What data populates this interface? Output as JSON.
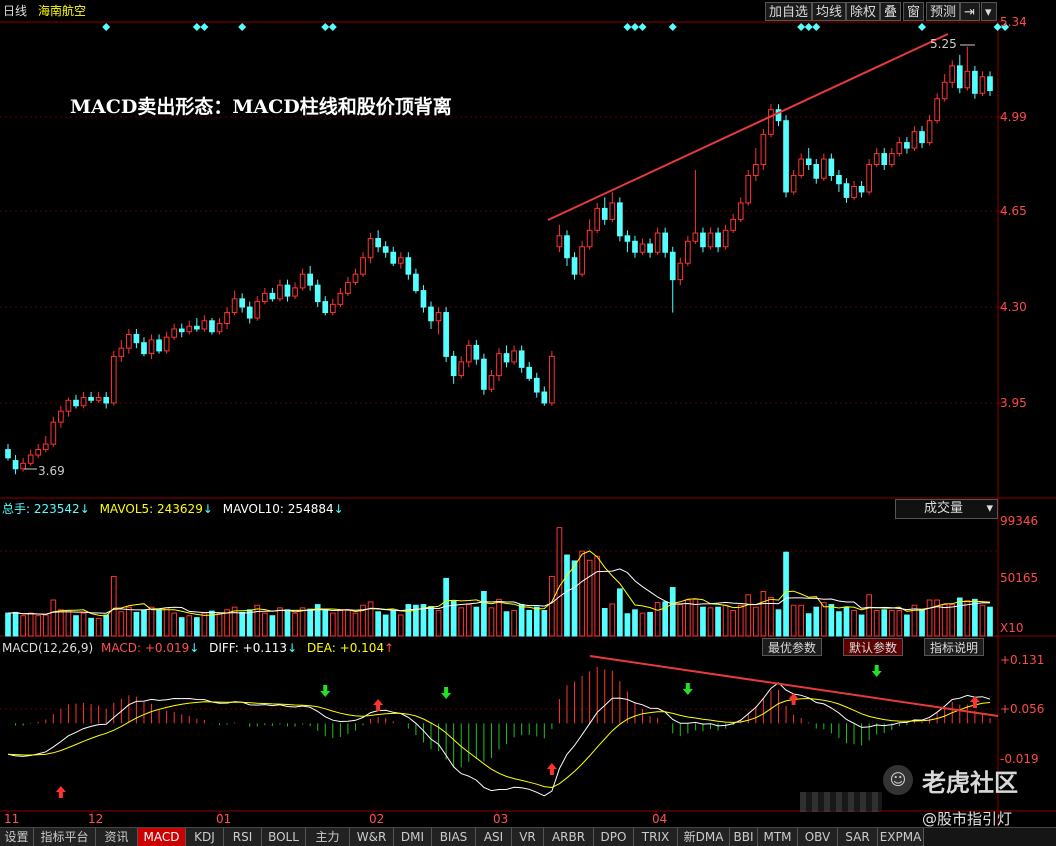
{
  "header": {
    "period": "日线",
    "stock_name": "海南航空",
    "buttons": [
      "加自选",
      "均线",
      "除权",
      "叠",
      "窗",
      "预测"
    ]
  },
  "annotation": {
    "title": "MACD卖出形态：MACD柱线和股价顶背离"
  },
  "price_axis": [
    "5.34",
    "4.99",
    "4.65",
    "4.30",
    "3.95"
  ],
  "price_marks": {
    "high": "5.25",
    "low": "3.69"
  },
  "volume_header": {
    "total_label": "总手:",
    "total_value": "223542",
    "mavol5_label": "MAVOL5:",
    "mavol5_value": "243629",
    "mavol10_label": "MAVOL10:",
    "mavol10_value": "254884",
    "selector": "成交量"
  },
  "volume_axis": [
    "99346",
    "50165",
    "X10"
  ],
  "macd_header": {
    "name": "MACD(12,26,9)",
    "macd_label": "MACD:",
    "macd_value": "+0.019",
    "diff_label": "DIFF:",
    "diff_value": "+0.113",
    "dea_label": "DEA:",
    "dea_value": "+0.104"
  },
  "macd_buttons": [
    "最优参数",
    "默认参数",
    "指标说明"
  ],
  "macd_axis": [
    "+0.131",
    "+0.056",
    "-0.019"
  ],
  "x_axis_months": [
    "11",
    "12",
    "01",
    "02",
    "03",
    "04"
  ],
  "bottom_tabs": [
    "设置",
    "指标平台",
    "资讯",
    "MACD",
    "KDJ",
    "RSI",
    "BOLL",
    "主力",
    "W&R",
    "DMI",
    "BIAS",
    "ASI",
    "VR",
    "ARBR",
    "DPO",
    "TRIX",
    "新DMA",
    "BBI",
    "MTM",
    "OBV",
    "SAR",
    "EXPMA"
  ],
  "watermark": {
    "brand": "老虎社区",
    "author": "@股市指引灯"
  },
  "colors": {
    "up": "#ff3232",
    "down": "#54ffff",
    "diff": "#ffffff",
    "dea": "#ffff00",
    "trend": "#e83a3a",
    "grid": "#8b0000"
  },
  "chart_data": {
    "type": "candlestick",
    "price_range": [
      3.62,
      5.4
    ],
    "candles": [
      [
        3.78,
        3.75,
        3.8,
        3.74
      ],
      [
        3.74,
        3.71,
        3.76,
        3.69
      ],
      [
        3.71,
        3.73,
        3.75,
        3.7
      ],
      [
        3.73,
        3.76,
        3.78,
        3.72
      ],
      [
        3.76,
        3.78,
        3.8,
        3.75
      ],
      [
        3.78,
        3.8,
        3.83,
        3.77
      ],
      [
        3.8,
        3.88,
        3.9,
        3.79
      ],
      [
        3.88,
        3.92,
        3.94,
        3.86
      ],
      [
        3.92,
        3.96,
        3.97,
        3.9
      ],
      [
        3.96,
        3.94,
        3.98,
        3.93
      ],
      [
        3.94,
        3.97,
        3.99,
        3.93
      ],
      [
        3.97,
        3.96,
        3.99,
        3.95
      ],
      [
        3.96,
        3.97,
        3.99,
        3.95
      ],
      [
        3.97,
        3.95,
        3.99,
        3.93
      ],
      [
        3.95,
        4.12,
        4.14,
        3.94
      ],
      [
        4.12,
        4.15,
        4.18,
        4.1
      ],
      [
        4.15,
        4.2,
        4.22,
        4.13
      ],
      [
        4.2,
        4.17,
        4.22,
        4.15
      ],
      [
        4.17,
        4.13,
        4.19,
        4.12
      ],
      [
        4.13,
        4.18,
        4.2,
        4.11
      ],
      [
        4.18,
        4.14,
        4.2,
        4.13
      ],
      [
        4.14,
        4.19,
        4.21,
        4.13
      ],
      [
        4.19,
        4.22,
        4.24,
        4.18
      ],
      [
        4.22,
        4.21,
        4.24,
        4.19
      ],
      [
        4.21,
        4.23,
        4.25,
        4.2
      ],
      [
        4.23,
        4.22,
        4.26,
        4.21
      ],
      [
        4.22,
        4.25,
        4.27,
        4.21
      ],
      [
        4.25,
        4.21,
        4.26,
        4.2
      ],
      [
        4.21,
        4.24,
        4.26,
        4.2
      ],
      [
        4.24,
        4.28,
        4.3,
        4.22
      ],
      [
        4.28,
        4.33,
        4.36,
        4.27
      ],
      [
        4.33,
        4.3,
        4.35,
        4.28
      ],
      [
        4.3,
        4.26,
        4.32,
        4.24
      ],
      [
        4.26,
        4.32,
        4.34,
        4.25
      ],
      [
        4.32,
        4.35,
        4.37,
        4.31
      ],
      [
        4.35,
        4.33,
        4.37,
        4.32
      ],
      [
        4.33,
        4.38,
        4.4,
        4.32
      ],
      [
        4.38,
        4.34,
        4.4,
        4.32
      ],
      [
        4.34,
        4.37,
        4.39,
        4.33
      ],
      [
        4.37,
        4.42,
        4.44,
        4.36
      ],
      [
        4.42,
        4.38,
        4.45,
        4.36
      ],
      [
        4.38,
        4.32,
        4.4,
        4.3
      ],
      [
        4.32,
        4.28,
        4.34,
        4.27
      ],
      [
        4.28,
        4.31,
        4.33,
        4.27
      ],
      [
        4.31,
        4.35,
        4.37,
        4.3
      ],
      [
        4.35,
        4.39,
        4.41,
        4.34
      ],
      [
        4.39,
        4.42,
        4.44,
        4.38
      ],
      [
        4.42,
        4.48,
        4.5,
        4.41
      ],
      [
        4.48,
        4.55,
        4.57,
        4.46
      ],
      [
        4.55,
        4.52,
        4.58,
        4.5
      ],
      [
        4.52,
        4.5,
        4.54,
        4.48
      ],
      [
        4.5,
        4.46,
        4.52,
        4.45
      ],
      [
        4.46,
        4.48,
        4.5,
        4.44
      ],
      [
        4.48,
        4.42,
        4.5,
        4.4
      ],
      [
        4.42,
        4.36,
        4.44,
        4.35
      ],
      [
        4.36,
        4.3,
        4.38,
        4.28
      ],
      [
        4.3,
        4.25,
        4.32,
        4.22
      ],
      [
        4.25,
        4.28,
        4.3,
        4.2
      ],
      [
        4.28,
        4.12,
        4.3,
        4.1
      ],
      [
        4.12,
        4.05,
        4.14,
        4.02
      ],
      [
        4.05,
        4.1,
        4.12,
        4.04
      ],
      [
        4.1,
        4.16,
        4.18,
        4.08
      ],
      [
        4.16,
        4.11,
        4.18,
        4.09
      ],
      [
        4.11,
        4.0,
        4.13,
        3.98
      ],
      [
        4.0,
        4.05,
        4.07,
        3.99
      ],
      [
        4.05,
        4.13,
        4.15,
        4.03
      ],
      [
        4.13,
        4.1,
        4.16,
        4.08
      ],
      [
        4.1,
        4.14,
        4.16,
        4.09
      ],
      [
        4.14,
        4.08,
        4.16,
        4.06
      ],
      [
        4.08,
        4.04,
        4.1,
        4.03
      ],
      [
        4.04,
        3.99,
        4.06,
        3.97
      ],
      [
        3.99,
        3.95,
        4.01,
        3.94
      ],
      [
        3.95,
        4.12,
        4.14,
        3.94
      ],
      [
        4.52,
        4.56,
        4.6,
        4.5
      ],
      [
        4.56,
        4.48,
        4.58,
        4.45
      ],
      [
        4.48,
        4.42,
        4.5,
        4.4
      ],
      [
        4.42,
        4.52,
        4.54,
        4.41
      ],
      [
        4.52,
        4.58,
        4.62,
        4.51
      ],
      [
        4.58,
        4.66,
        4.68,
        4.57
      ],
      [
        4.66,
        4.62,
        4.7,
        4.6
      ],
      [
        4.62,
        4.68,
        4.72,
        4.61
      ],
      [
        4.68,
        4.56,
        4.7,
        4.54
      ],
      [
        4.56,
        4.54,
        4.58,
        4.5
      ],
      [
        4.54,
        4.5,
        4.56,
        4.48
      ],
      [
        4.5,
        4.53,
        4.55,
        4.49
      ],
      [
        4.53,
        4.5,
        4.55,
        4.48
      ],
      [
        4.5,
        4.57,
        4.59,
        4.49
      ],
      [
        4.57,
        4.5,
        4.59,
        4.48
      ],
      [
        4.5,
        4.4,
        4.52,
        4.28
      ],
      [
        4.4,
        4.46,
        4.48,
        4.38
      ],
      [
        4.46,
        4.54,
        4.56,
        4.45
      ],
      [
        4.54,
        4.57,
        4.8,
        4.53
      ],
      [
        4.57,
        4.52,
        4.59,
        4.5
      ],
      [
        4.52,
        4.57,
        4.59,
        4.51
      ],
      [
        4.57,
        4.52,
        4.59,
        4.5
      ],
      [
        4.52,
        4.58,
        4.6,
        4.51
      ],
      [
        4.58,
        4.62,
        4.64,
        4.57
      ],
      [
        4.62,
        4.68,
        4.7,
        4.61
      ],
      [
        4.68,
        4.78,
        4.8,
        4.67
      ],
      [
        4.78,
        4.82,
        4.88,
        4.76
      ],
      [
        4.82,
        4.93,
        4.95,
        4.8
      ],
      [
        4.93,
        5.02,
        5.04,
        4.92
      ],
      [
        5.02,
        4.98,
        5.04,
        4.96
      ],
      [
        4.98,
        4.72,
        5.0,
        4.7
      ],
      [
        4.72,
        4.78,
        4.8,
        4.71
      ],
      [
        4.78,
        4.84,
        4.86,
        4.77
      ],
      [
        4.84,
        4.82,
        4.88,
        4.8
      ],
      [
        4.82,
        4.77,
        4.84,
        4.75
      ],
      [
        4.77,
        4.84,
        4.86,
        4.76
      ],
      [
        4.84,
        4.78,
        4.86,
        4.76
      ],
      [
        4.78,
        4.75,
        4.8,
        4.72
      ],
      [
        4.75,
        4.7,
        4.77,
        4.68
      ],
      [
        4.7,
        4.74,
        4.76,
        4.69
      ],
      [
        4.74,
        4.72,
        4.76,
        4.7
      ],
      [
        4.72,
        4.82,
        4.84,
        4.71
      ],
      [
        4.82,
        4.86,
        4.88,
        4.81
      ],
      [
        4.86,
        4.82,
        4.88,
        4.8
      ],
      [
        4.82,
        4.86,
        4.88,
        4.81
      ],
      [
        4.86,
        4.9,
        4.92,
        4.85
      ],
      [
        4.9,
        4.88,
        4.92,
        4.86
      ],
      [
        4.88,
        4.94,
        4.96,
        4.87
      ],
      [
        4.94,
        4.9,
        4.96,
        4.88
      ],
      [
        4.9,
        4.98,
        5.0,
        4.89
      ],
      [
        4.98,
        5.06,
        5.08,
        4.97
      ],
      [
        5.06,
        5.12,
        5.15,
        5.05
      ],
      [
        5.12,
        5.18,
        5.2,
        5.1
      ],
      [
        5.18,
        5.1,
        5.22,
        5.08
      ],
      [
        5.1,
        5.16,
        5.25,
        5.09
      ],
      [
        5.16,
        5.08,
        5.18,
        5.06
      ],
      [
        5.08,
        5.14,
        5.16,
        5.07
      ],
      [
        5.14,
        5.09,
        5.16,
        5.07
      ]
    ],
    "volume_range": [
      0,
      110000
    ],
    "volume_axis_labels": [
      99346,
      50165
    ],
    "macd_range": [
      -0.1,
      0.15
    ],
    "macd_axis_labels": [
      0.131,
      0.056,
      -0.019
    ],
    "macd_final": {
      "macd": 0.019,
      "diff": 0.113,
      "dea": 0.104
    }
  }
}
